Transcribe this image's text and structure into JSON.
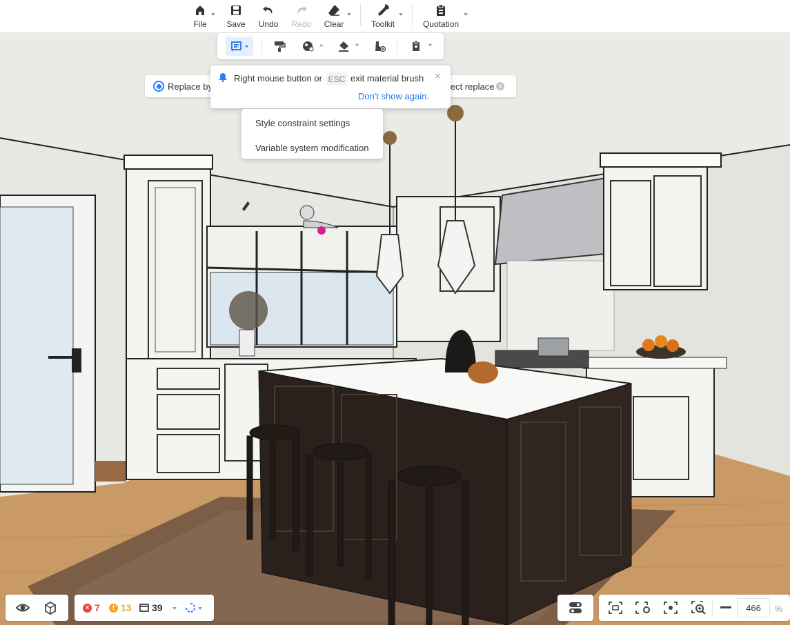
{
  "toolbar": {
    "items": [
      {
        "label": "File",
        "icon": "home-icon",
        "disabled": false
      },
      {
        "label": "Save",
        "icon": "save-icon",
        "disabled": false
      },
      {
        "label": "Undo",
        "icon": "undo-icon",
        "disabled": false
      },
      {
        "label": "Redo",
        "icon": "redo-icon",
        "disabled": true
      },
      {
        "label": "Clear",
        "icon": "eraser-icon",
        "disabled": false
      },
      {
        "label": "Toolkit",
        "icon": "wrench-icon",
        "disabled": false
      },
      {
        "label": "Quotation",
        "icon": "clipboard-icon",
        "disabled": false
      }
    ]
  },
  "subtoolbar": {
    "items": [
      "material-brush-icon",
      "paint-roller-icon",
      "texture-ball-icon",
      "fill-bucket-icon",
      "shoe-plus-icon",
      "clipboard-copy-icon"
    ]
  },
  "replace_bar": {
    "left_label": "Replace by",
    "right_label": "lect replace",
    "info_glyph": "i"
  },
  "tip": {
    "text_before": "Right mouse button or",
    "key": "ESC",
    "text_after": "exit material brush",
    "close_glyph": "×",
    "dont_show": "Don't show again."
  },
  "menu": {
    "items": [
      "Style constraint settings",
      "Variable system modification"
    ]
  },
  "status": {
    "errors": "7",
    "error_glyph": "×",
    "warnings": "13",
    "warning_glyph": "!",
    "objects": "39"
  },
  "zoom": {
    "value": "466",
    "unit": "%"
  },
  "colors": {
    "accent": "#2f7ff3",
    "link": "#1d7bf0",
    "error": "#e8453c",
    "warning": "#f5a623"
  }
}
